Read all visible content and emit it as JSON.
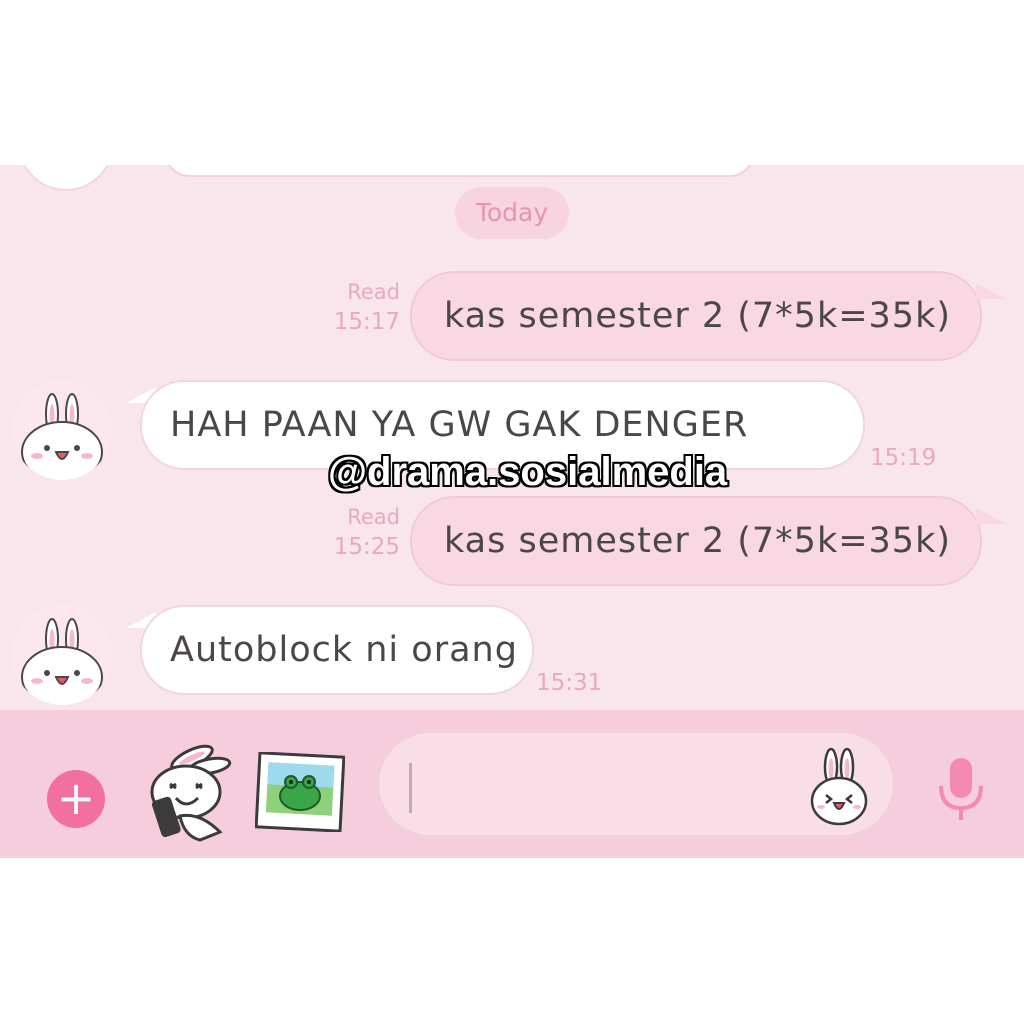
{
  "chat": {
    "date_label": "Today",
    "messages": [
      {
        "direction": "out",
        "text": "kas semester 2 (7*5k=35k)",
        "status": "Read",
        "time": "15:17"
      },
      {
        "direction": "in",
        "text": "HAH PAAN YA GW GAK DENGER",
        "time": "15:19"
      },
      {
        "direction": "out",
        "text": "kas semester 2 (7*5k=35k)",
        "status": "Read",
        "time": "15:25"
      },
      {
        "direction": "in",
        "text": "Autoblock ni orang",
        "time": "15:31"
      }
    ]
  },
  "input_bar": {
    "plus_icon": "+",
    "sticker_icon": "bunny-sticker-icon",
    "photo_icon": "photo-icon",
    "emoji_icon": "bunny-emoji-icon",
    "mic_icon": "microphone-icon",
    "placeholder": ""
  },
  "watermark": "@drama.sosialmedia",
  "colors": {
    "chat_bg": "#f9e6ec",
    "outgoing_bubble": "#f9d7e3",
    "incoming_bubble": "#ffffff",
    "accent": "#f26fa1",
    "meta_text": "#e9a9bd"
  }
}
